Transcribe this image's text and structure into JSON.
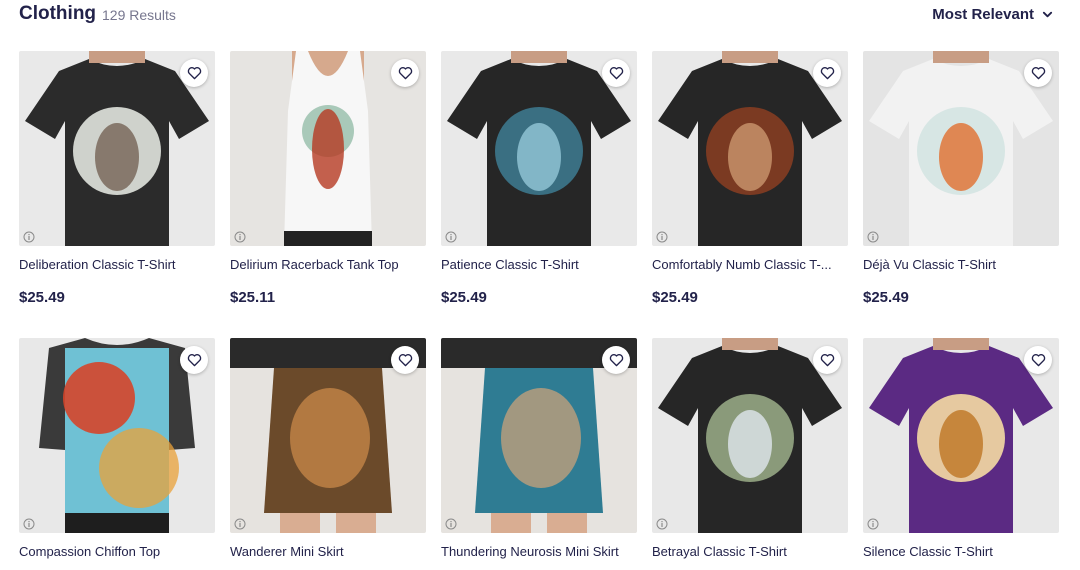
{
  "header": {
    "title": "Clothing",
    "results": "129 Results",
    "sort_label": "Most Relevant"
  },
  "products": [
    {
      "name": "Deliberation Classic T-Shirt",
      "price": "$25.49",
      "garment": "tee",
      "bg": "#e9e9e9",
      "fabric": "#2b2b2b",
      "art": [
        "#cfd2cc",
        "#7a6a5c"
      ]
    },
    {
      "name": "Delirium Racerback Tank Top",
      "price": "$25.11",
      "garment": "tank",
      "bg": "#e6e4e1",
      "fabric": "#f7f7f7",
      "art": [
        "#a9c9b9",
        "#b53a22"
      ]
    },
    {
      "name": "Patience Classic T-Shirt",
      "price": "$25.49",
      "garment": "tee",
      "bg": "#e9e9e9",
      "fabric": "#262626",
      "art": [
        "#3a6f82",
        "#8fc3d3"
      ]
    },
    {
      "name": "Comfortably Numb Classic T-...",
      "price": "$25.49",
      "garment": "tee",
      "bg": "#e9e9e9",
      "fabric": "#262626",
      "art": [
        "#7b3a22",
        "#c7926a"
      ]
    },
    {
      "name": "Déjà Vu Classic T-Shirt",
      "price": "$25.49",
      "garment": "tee",
      "bg": "#e4e4e4",
      "fabric": "#f2f2f2",
      "art": [
        "#d7e6e4",
        "#e0753a"
      ]
    },
    {
      "name": "Compassion Chiffon Top",
      "price": "",
      "garment": "chiffon",
      "bg": "#e8e8e8",
      "fabric": "#3a3a3a",
      "art": [
        "#d5452a",
        "#6fc1d4"
      ]
    },
    {
      "name": "Wanderer Mini Skirt",
      "price": "",
      "garment": "skirt",
      "bg": "#e6e3df",
      "fabric": "#222222",
      "art": [
        "#6b4a2a",
        "#c9894a"
      ]
    },
    {
      "name": "Thundering Neurosis Mini Skirt",
      "price": "",
      "garment": "skirt",
      "bg": "#e6e3df",
      "fabric": "#222222",
      "art": [
        "#2f7c93",
        "#caa27a"
      ]
    },
    {
      "name": "Betrayal Classic T-Shirt",
      "price": "",
      "garment": "tee",
      "bg": "#e8e8e8",
      "fabric": "#262626",
      "art": [
        "#8a9a7a",
        "#d9e2e6"
      ]
    },
    {
      "name": "Silence Classic T-Shirt",
      "price": "",
      "garment": "tee",
      "bg": "#e8e8e8",
      "fabric": "#5b2a83",
      "art": [
        "#e6c9a0",
        "#c07a2a"
      ]
    }
  ]
}
